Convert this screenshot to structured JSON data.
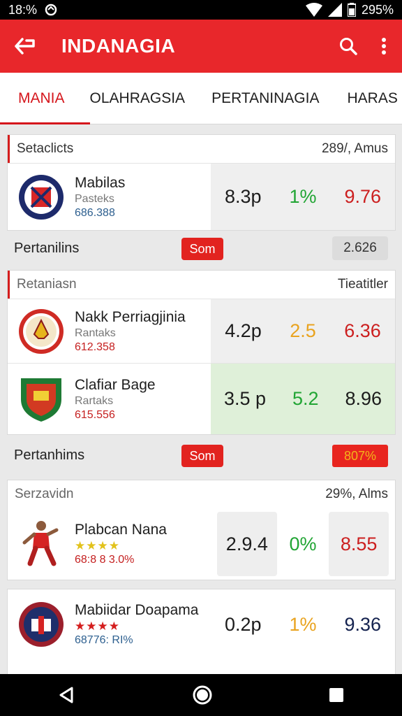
{
  "status_bar": {
    "time": "18:%",
    "battery": "295%"
  },
  "app_bar": {
    "title": "INDANAGIA"
  },
  "tabs": [
    "MANIA",
    "OLAHRAGSIA",
    "PERTANINAGIA",
    "HARAS"
  ],
  "card1": {
    "title": "Setaclicts",
    "right": "289/, Amus",
    "row": {
      "name": "Mabilas",
      "sub": "Pasteks",
      "num": "686.388",
      "odds": [
        "8.3p",
        "1%",
        "9.76"
      ]
    }
  },
  "bar1": {
    "label": "Pertanilins",
    "badge": "Som",
    "value": "2.626"
  },
  "card2": {
    "title": "Retaniasn",
    "right": "Tieatitler",
    "rows": [
      {
        "name": "Nakk Perriagjinia",
        "sub": "Rantaks",
        "num": "612.358",
        "odds": [
          "4.2p",
          "2.5",
          "6.36"
        ]
      },
      {
        "name": "Clafiar Bage",
        "sub": "Rartaks",
        "num": "615.556",
        "odds": [
          "3.5 p",
          "5.2",
          "8.96"
        ]
      }
    ]
  },
  "bar2": {
    "label": "Pertanhims",
    "badge": "Som",
    "value": "807%"
  },
  "card3": {
    "title": "Serzavidn",
    "right": "29%, Alms",
    "rows": [
      {
        "name": "Plabcan Nana",
        "stars": "★★★★",
        "num": "68:8 8 3.0%",
        "odds": [
          "2.9.4",
          "0%",
          "8.55"
        ]
      },
      {
        "name": "Mabiidar Doapama",
        "stars": "★★★★",
        "num": "68776: RI%",
        "odds": [
          "0.2p",
          "1%",
          "9.36"
        ]
      }
    ]
  },
  "icons": [
    "wifi-icon",
    "signal-icon",
    "battery-icon",
    "back-arrow-icon",
    "search-icon",
    "more-vert-icon",
    "nav-back-icon",
    "nav-home-icon",
    "nav-recents-icon"
  ]
}
